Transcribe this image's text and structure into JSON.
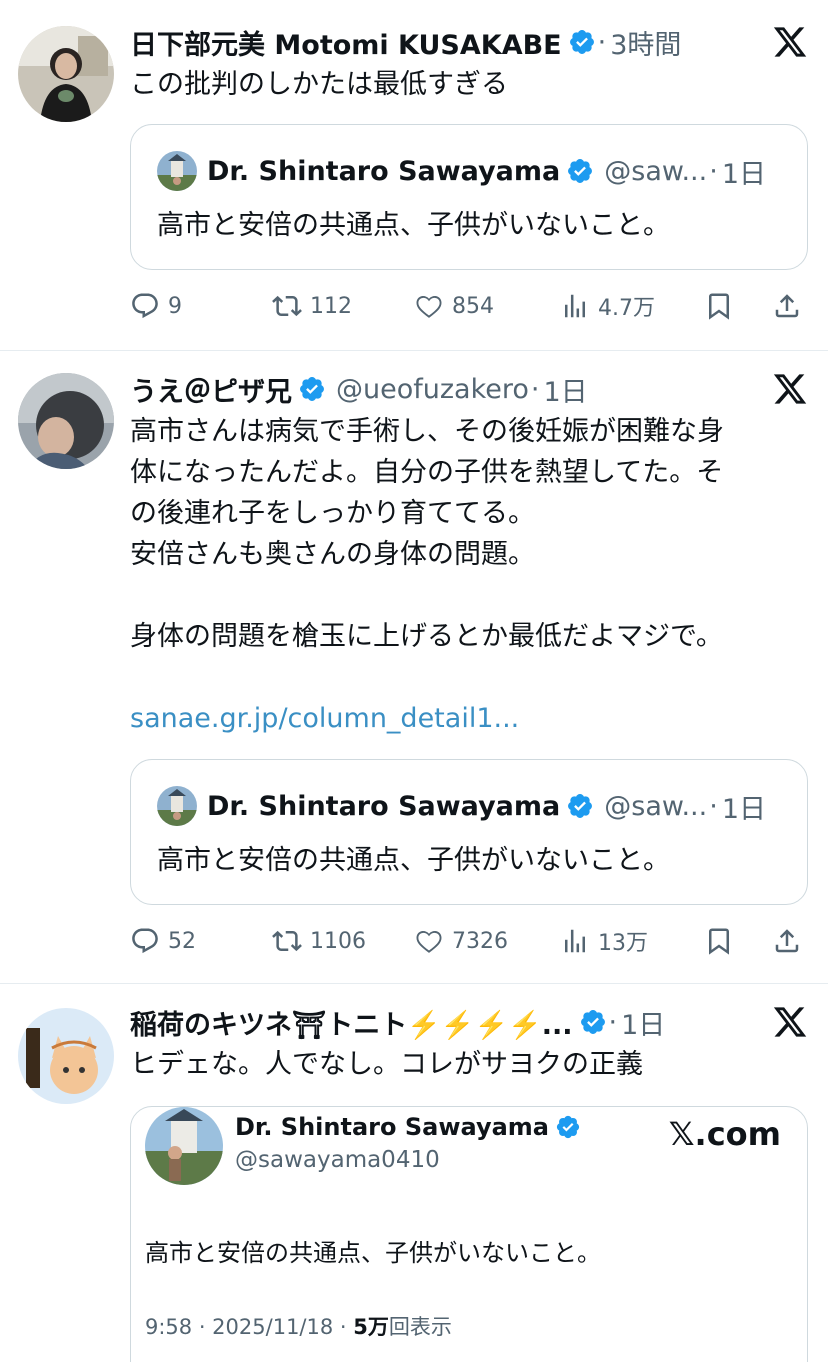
{
  "tweets": [
    {
      "name": "日下部元美 Motomi KUSAKABE",
      "handle": "",
      "time": "3時間",
      "text": "この批判のしかたは最低すぎる",
      "quote": {
        "name": "Dr. Shintaro Sawayama",
        "handle": "@saw...",
        "time": "1日",
        "text": "高市と安倍の共通点、子供がいないこと。"
      },
      "stats": {
        "replies": "9",
        "reposts": "112",
        "likes": "854",
        "views": "4.7万"
      }
    },
    {
      "name": "うえ＠ピザ兄",
      "handle": "@ueofuzakero",
      "time": "1日",
      "text": "高市さんは病気で手術し、その後妊娠が困難な身\n体になったんだよ。自分の子供を熱望してた。そ\nの後連れ子をしっかり育ててる。\n安倍さんも奥さんの身体の問題。\n\n身体の問題を槍玉に上げるとか最低だよマジで。",
      "link": "sanae.gr.jp/column_detail1...",
      "quote": {
        "name": "Dr. Shintaro Sawayama",
        "handle": "@saw...",
        "time": "1日",
        "text": "高市と安倍の共通点、子供がいないこと。"
      },
      "stats": {
        "replies": "52",
        "reposts": "1106",
        "likes": "7326",
        "views": "13万"
      }
    },
    {
      "name": "稲荷のキツネ⛩トニト⚡️⚡️⚡️⚡️...",
      "handle": "",
      "time": "1日",
      "text": "ヒデェな。人でなし。コレがサヨクの正義",
      "card": {
        "name": "Dr. Shintaro Sawayama",
        "handle": "@sawayama0410",
        "brand": "𝕏.com",
        "text": "高市と安倍の共通点、子供がいないこと。",
        "meta_time": "9:58 · 2025/11/18 · ",
        "meta_views_num": "5万",
        "meta_views_label": "回表示"
      }
    }
  ],
  "icons": {
    "verified": "verified-badge-icon",
    "x_logo": "x-logo-icon",
    "reply": "reply-icon",
    "repost": "repost-icon",
    "like": "heart-icon",
    "views": "views-icon",
    "bookmark": "bookmark-icon",
    "share": "share-icon"
  },
  "colors": {
    "verified": "#1d9bf0",
    "link": "#3a8fc4",
    "muted": "#536471"
  }
}
